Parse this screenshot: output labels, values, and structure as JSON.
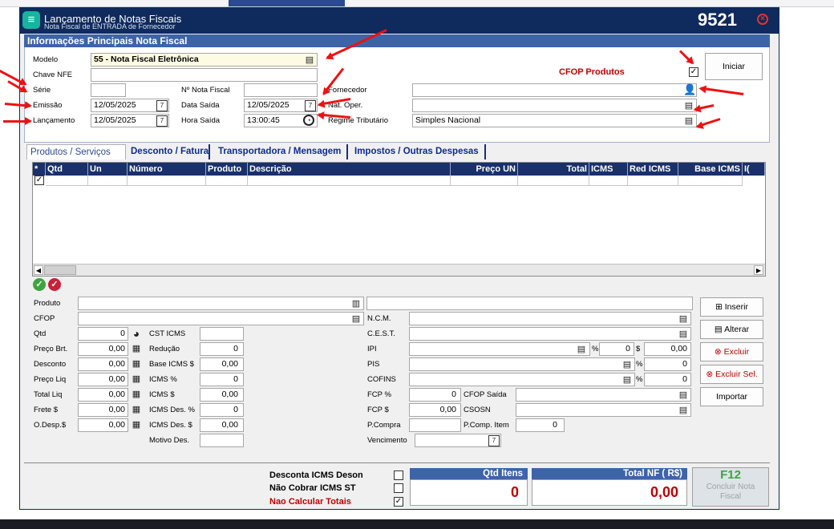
{
  "window": {
    "title": "Lançamento de Notas Fiscais",
    "subtitle": "Nota Fiscal de ENTRADA de Fornecedor",
    "number": "9521"
  },
  "info": {
    "header": "Informações Principais Nota Fiscal",
    "modelo_label": "Modelo",
    "modelo_value": "55 - Nota Fiscal Eletrônica",
    "chave_label": "Chave NFE",
    "chave_value": "",
    "serie_label": "Série",
    "serie_value": "",
    "nota_label": "Nº Nota Fiscal",
    "nota_value": "",
    "emissao_label": "Emissão",
    "emissao_value": "12/05/2025",
    "lancamento_label": "Lançamento",
    "lancamento_value": "12/05/2025",
    "data_saida_label": "Data Saída",
    "data_saida_value": "12/05/2025",
    "hora_saida_label": "Hora Saída",
    "hora_saida_value": "13:00:45",
    "fornecedor_label": "Fornecedor",
    "fornecedor_value": "",
    "natoper_label": "Nat. Oper.",
    "natoper_value": "",
    "regime_label": "Regime Tributário",
    "regime_value": "Simples Nacional",
    "cfop_produtos_label": "CFOP Produtos",
    "iniciar_label": "Iniciar"
  },
  "tabs": [
    "Produtos / Serviços",
    "Desconto / Fatura",
    "Transportadora / Mensagem",
    "Impostos / Outras Despesas"
  ],
  "grid": {
    "columns": [
      "*",
      "Qtd",
      "Un",
      "Número",
      "Produto",
      "Descrição",
      "Preço UN",
      "Total",
      "ICMS",
      "Red ICMS",
      "Base ICMS",
      "I("
    ]
  },
  "form": {
    "produto_label": "Produto",
    "cfop_label": "CFOP",
    "qtd_label": "Qtd",
    "qtd_value": "0",
    "preco_brt_label": "Preço Brt.",
    "preco_brt_value": "0,00",
    "desconto_label": "Desconto",
    "desconto_value": "0,00",
    "preco_liq_label": "Preço Liq",
    "preco_liq_value": "0,00",
    "total_liq_label": "Total Liq",
    "total_liq_value": "0,00",
    "frete_label": "Frete $",
    "frete_value": "0,00",
    "odesp_label": "O.Desp.$",
    "odesp_value": "0,00",
    "cst_icms_label": "CST ICMS",
    "cst_icms_value": "",
    "reducao_label": "Redução",
    "reducao_value": "0",
    "base_icms_label": "Base ICMS $",
    "base_icms_value": "0,00",
    "icms_pct_label": "ICMS %",
    "icms_pct_value": "0",
    "icms_val_label": "ICMS $",
    "icms_val_value": "0,00",
    "icms_des_pct_label": "ICMS Des. %",
    "icms_des_pct_value": "0",
    "icms_des_val_label": "ICMS Des. $",
    "icms_des_val_value": "0,00",
    "motivo_des_label": "Motivo Des.",
    "motivo_des_value": "",
    "ncm_label": "N.C.M.",
    "cest_label": "C.E.S.T.",
    "ipi_label": "IPI",
    "ipi_pct_value": "0",
    "ipi_val_value": "0,00",
    "pis_label": "PIS",
    "pis_value": "0",
    "cofins_label": "COFINS",
    "cofins_value": "0",
    "fcp_pct_label": "FCP %",
    "fcp_pct_value": "0",
    "fcp_val_label": "FCP $",
    "fcp_val_value": "0,00",
    "pcompra_label": "P.Compra",
    "cfop_saida_label": "CFOP Saída",
    "csosn_label": "CSOSN",
    "pcomp_item_label": "P.Comp. Item",
    "pcomp_item_value": "0",
    "vencimento_label": "Vencimento",
    "pct_symbol": "%",
    "dollar_symbol": "$"
  },
  "actions": {
    "inserir": "Inserir",
    "alterar": "Alterar",
    "excluir": "Excluir",
    "excluir_sel": "Excluir Sel.",
    "importar": "Importar"
  },
  "footer": {
    "desconta_icms_deson": "Desconta ICMS Deson",
    "nao_cobrar_icms_st": "Não Cobrar ICMS ST",
    "nao_calcular_totais": "Nao Calcular Totais",
    "qtd_itens_label": "Qtd Itens",
    "qtd_itens_value": "0",
    "total_nf_label": "Total NF ( R$)",
    "total_nf_value": "0,00",
    "f12_label": "F12",
    "concluir_label": "Concluir Nota Fiscal"
  },
  "colors": {
    "title_bg": "#0f2a5c",
    "header_bg": "#3e64a8",
    "grid_header_bg": "#19306b",
    "accent_red": "#c00000",
    "annotation_arrow": "#ee1111"
  }
}
